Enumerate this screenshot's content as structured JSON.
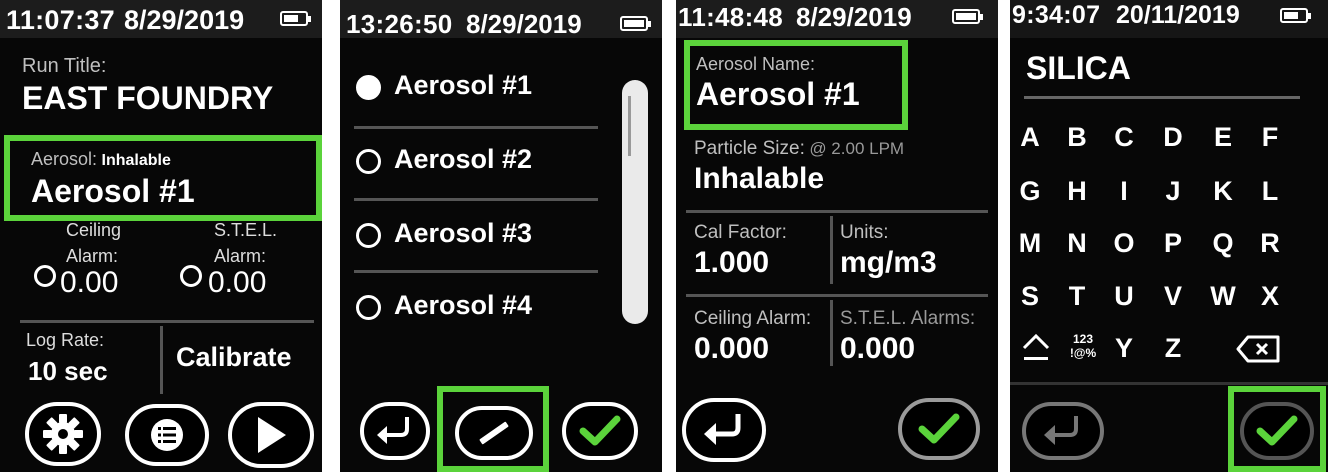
{
  "screen1": {
    "time": "11:07:37",
    "date": "8/29/2019",
    "run_title_label": "Run Title:",
    "run_title": "EAST FOUNDRY",
    "aerosol_label": "Aerosol:",
    "aerosol_type": "Inhalable",
    "aerosol_name": "Aerosol #1",
    "ceiling_label": "Ceiling",
    "ceiling_alarm_label": "Alarm:",
    "ceiling_value": "0.00",
    "stel_label": "S.T.E.L.",
    "stel_alarm_label": "Alarm:",
    "stel_value": "0.00",
    "log_rate_label": "Log Rate:",
    "log_rate_value": "10 sec",
    "calibrate_label": "Calibrate",
    "icons": [
      "gear-icon",
      "list-icon",
      "play-icon"
    ]
  },
  "screen2": {
    "time": "13:26:50",
    "date": "8/29/2019",
    "items": [
      {
        "label": "Aerosol #1",
        "selected": true
      },
      {
        "label": "Aerosol #2",
        "selected": false
      },
      {
        "label": "Aerosol #3",
        "selected": false
      },
      {
        "label": "Aerosol #4",
        "selected": false
      }
    ],
    "icons": [
      "back-icon",
      "pencil-icon",
      "check-icon"
    ]
  },
  "screen3": {
    "time": "11:48:48",
    "date": "8/29/2019",
    "aerosol_name_label": "Aerosol Name:",
    "aerosol_name": "Aerosol #1",
    "particle_size_label": "Particle Size:",
    "flow_rate": "@ 2.00 LPM",
    "particle_size": "Inhalable",
    "cal_factor_label": "Cal Factor:",
    "cal_factor": "1.000",
    "units_label": "Units:",
    "units": "mg/m3",
    "ceiling_alarm_label": "Ceiling Alarm:",
    "ceiling_alarm": "0.000",
    "stel_alarms_label": "S.T.E.L. Alarms:",
    "stel_alarms": "0.000",
    "icons": [
      "back-icon",
      "check-icon"
    ]
  },
  "screen4": {
    "time": "9:34:07",
    "date": "20/11/2019",
    "input_value": "SILICA",
    "rows": [
      [
        "A",
        "B",
        "C",
        "D",
        "E",
        "F"
      ],
      [
        "G",
        "H",
        "I",
        "J",
        "K",
        "L"
      ],
      [
        "M",
        "N",
        "O",
        "P",
        "Q",
        "R"
      ],
      [
        "S",
        "T",
        "U",
        "V",
        "W",
        "X"
      ]
    ],
    "symbols_top": "123",
    "symbols_bottom": "!@%",
    "last_row": [
      "Y",
      "Z"
    ],
    "icons": [
      "shift-icon",
      "backspace-icon",
      "back-icon",
      "check-icon"
    ]
  },
  "colors": {
    "highlight": "#5bd33b",
    "check": "#5bd33b",
    "background": "#070707"
  }
}
